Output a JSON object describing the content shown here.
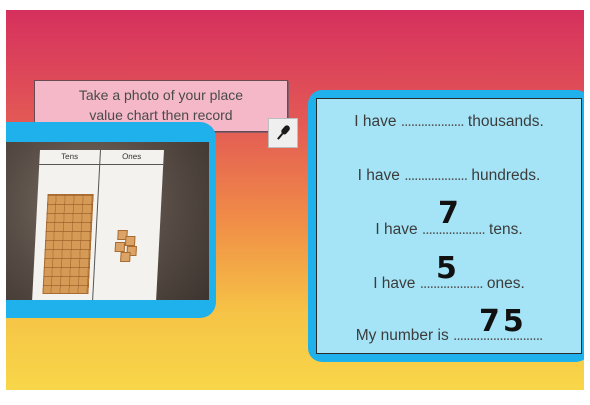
{
  "instruction": {
    "text": "Take a photo of your place\nvalue chart then record"
  },
  "photo": {
    "chart_headers": [
      "Tens",
      "Ones"
    ]
  },
  "mic_button": {
    "icon": "microphone-icon"
  },
  "worksheet": {
    "lines": [
      {
        "prefix": "I have",
        "blank": "...................",
        "suffix": "thousands."
      },
      {
        "prefix": "I have",
        "blank": "...................",
        "suffix": "hundreds."
      },
      {
        "prefix": "I have",
        "blank": "...................",
        "suffix": "tens."
      },
      {
        "prefix": "I have",
        "blank": "...................",
        "suffix": "ones."
      },
      {
        "prefix": "My number is",
        "blank": "...........................",
        "suffix": ""
      }
    ],
    "handwriting": {
      "tens": "7",
      "ones": "5",
      "number": "75"
    }
  },
  "colors": {
    "gradient_top": "#d6305e",
    "gradient_bottom": "#f8d649",
    "card_border": "#1fb1ec",
    "worksheet_fill": "#a4e4f6",
    "instruction_fill": "#f4b8c8"
  }
}
